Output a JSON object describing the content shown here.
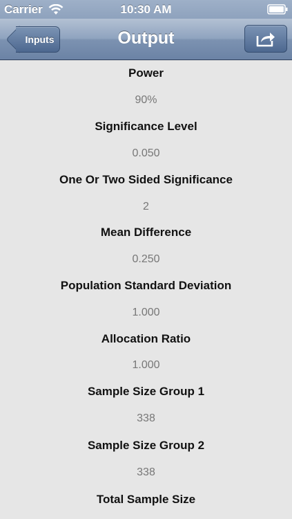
{
  "status_bar": {
    "carrier": "Carrier",
    "time": "10:30 AM"
  },
  "nav_bar": {
    "back_label": "Inputs",
    "title": "Output",
    "share_icon": "share-icon"
  },
  "results": [
    {
      "label": "Power",
      "value": "90%"
    },
    {
      "label": "Significance Level",
      "value": "0.050"
    },
    {
      "label": "One Or Two Sided Significance",
      "value": "2"
    },
    {
      "label": "Mean Difference",
      "value": "0.250"
    },
    {
      "label": "Population Standard Deviation",
      "value": "1.000"
    },
    {
      "label": "Allocation Ratio",
      "value": "1.000"
    },
    {
      "label": "Sample Size Group 1",
      "value": "338"
    },
    {
      "label": "Sample Size Group 2",
      "value": "338"
    },
    {
      "label": "Total Sample Size",
      "value": ""
    }
  ]
}
